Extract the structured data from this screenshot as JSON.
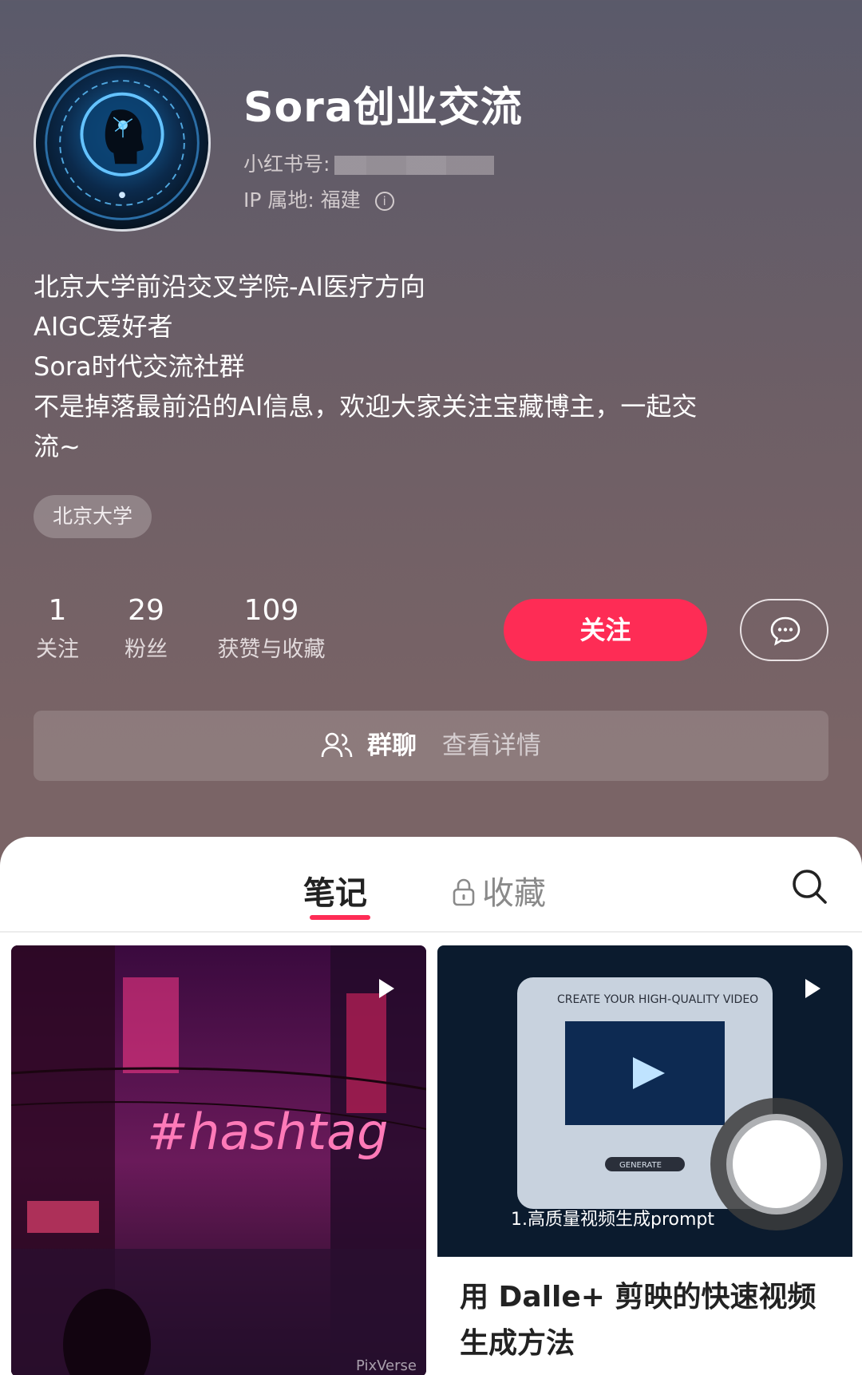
{
  "profile": {
    "name": "Sora创业交流",
    "id_label": "小红书号:",
    "ip_label": "IP 属地: 福建",
    "bio_lines": [
      "北京大学前沿交叉学院-AI医疗方向",
      "AIGC爱好者",
      "Sora时代交流社群",
      "不是掉落最前沿的AI信息，欢迎大家关注宝藏博主，一起交",
      "流~"
    ],
    "tag": "北京大学"
  },
  "stats": [
    {
      "num": "1",
      "label": "关注"
    },
    {
      "num": "29",
      "label": "粉丝"
    },
    {
      "num": "109",
      "label": "获赞与收藏"
    }
  ],
  "actions": {
    "follow_label": "关注"
  },
  "group": {
    "title": "群聊",
    "detail": "查看详情"
  },
  "tabs": {
    "notes": "笔记",
    "favorites": "收藏"
  },
  "cards": [
    {
      "image_text": "#hashtag",
      "watermark": "PixVerse"
    },
    {
      "image_header": "CREATE YOUR HIGH-QUALITY VIDEO",
      "image_button": "GENERATE",
      "image_caption": "1.高质量视频生成prompt",
      "title_line1": "用 Dalle+ 剪映的快速视频",
      "title_line2": "生成方法"
    }
  ],
  "colors": {
    "accent": "#fe2c55"
  }
}
